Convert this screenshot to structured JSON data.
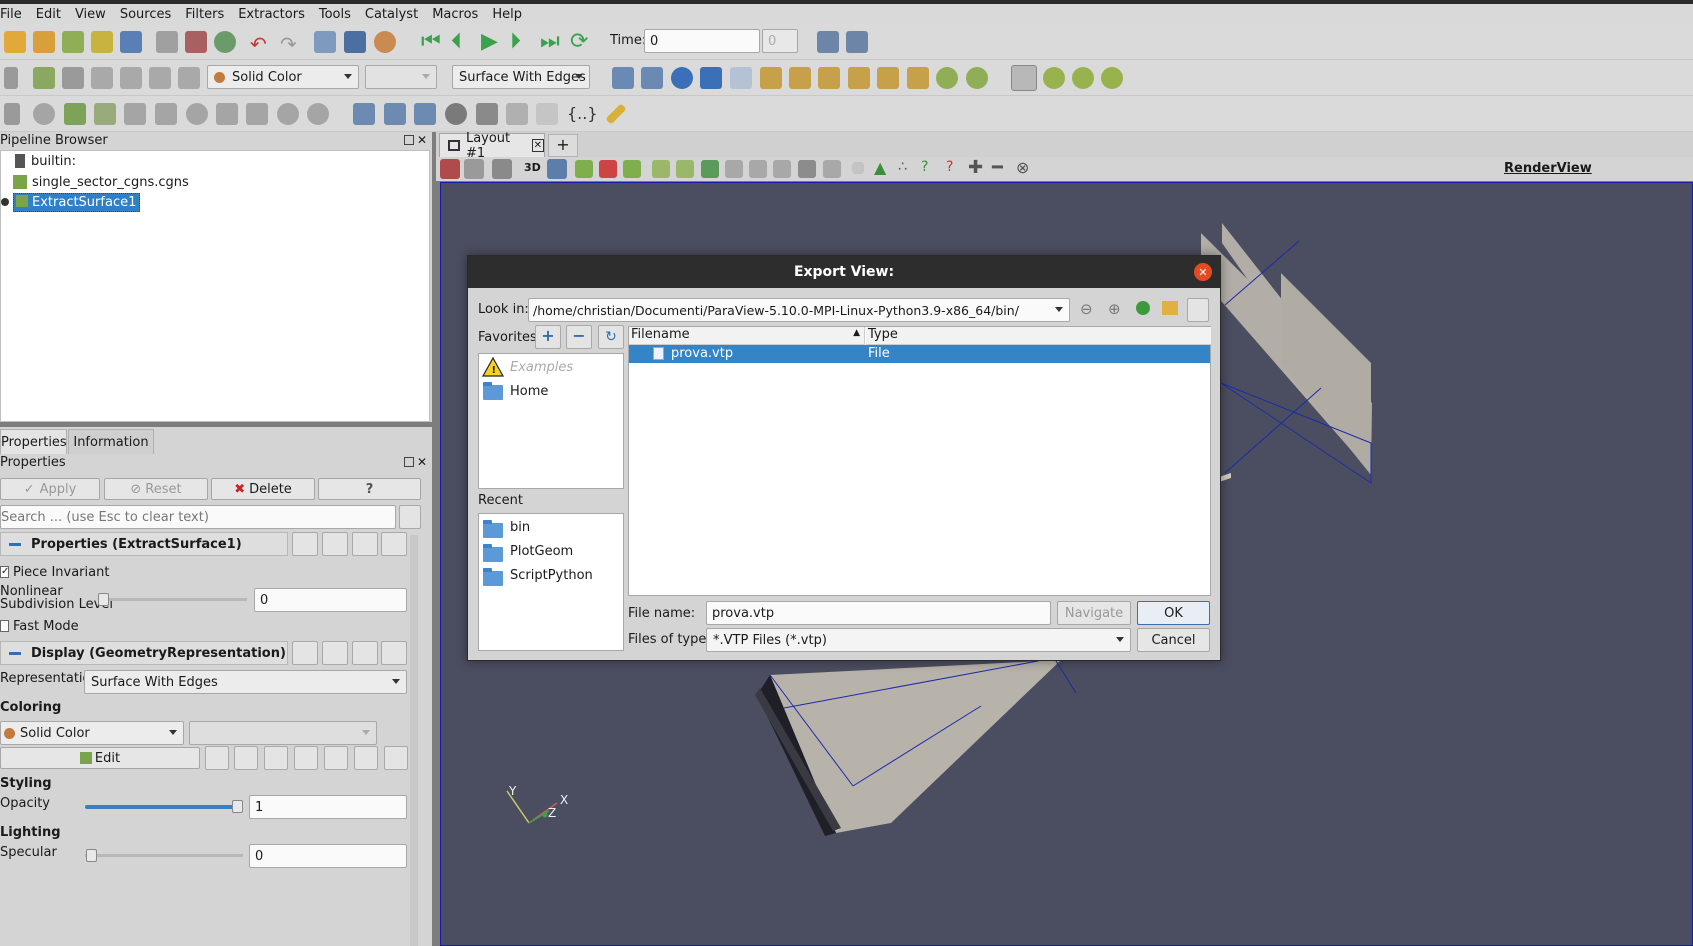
{
  "menu": [
    "File",
    "Edit",
    "View",
    "Sources",
    "Filters",
    "Extractors",
    "Tools",
    "Catalyst",
    "Macros",
    "Help"
  ],
  "toolbar": {
    "time_label": "Time:",
    "time_value": "0",
    "time_index": "0",
    "coloring_value": "Solid Color",
    "representation_value": "Surface With Edges",
    "view3d_label": "3D"
  },
  "pipeline": {
    "title": "Pipeline Browser",
    "items": [
      "builtin:",
      "single_sector_cgns.cgns",
      "ExtractSurface1"
    ]
  },
  "tabs": {
    "layout": "Layout #1",
    "add": "+",
    "properties_tab": "Properties",
    "information_tab": "Information"
  },
  "render_view_label": "RenderView",
  "properties": {
    "title": "Properties",
    "apply": "Apply",
    "reset": "Reset",
    "delete": "Delete",
    "help": "?",
    "search_placeholder": "Search ... (use Esc to clear text)",
    "section_props": "Properties (ExtractSurface1)",
    "piece_invariant": "Piece Invariant",
    "nonlinear_label_1": "Nonlinear",
    "nonlinear_label_2": "Subdivision Level",
    "nonlinear_value": "0",
    "fast_mode": "Fast Mode",
    "section_display": "Display (GeometryRepresentation)",
    "representation_label": "Representation",
    "representation_value": "Surface With Edges",
    "coloring_label": "Coloring",
    "coloring_value": "Solid Color",
    "edit": "Edit",
    "styling_label": "Styling",
    "opacity_label": "Opacity",
    "opacity_value": "1",
    "lighting_label": "Lighting",
    "specular_label": "Specular",
    "specular_value": "0"
  },
  "dialog": {
    "title": "Export View:",
    "look_in_label": "Look in:",
    "look_in_path": "/home/christian/Documenti/ParaView-5.10.0-MPI-Linux-Python3.9-x86_64/bin/",
    "favorites_label": "Favorites",
    "favorites": [
      "Examples",
      "Home"
    ],
    "recent_label": "Recent",
    "recent": [
      "bin",
      "PlotGeom",
      "ScriptPython"
    ],
    "columns": [
      "Filename",
      "Type"
    ],
    "files": [
      {
        "name": "prova.vtp",
        "type": "File"
      }
    ],
    "file_name_label": "File name:",
    "file_name_value": "prova.vtp",
    "navigate": "Navigate",
    "ok": "OK",
    "files_of_type_label": "Files of type:",
    "files_of_type_value": "*.VTP Files (*.vtp)",
    "cancel": "Cancel"
  },
  "axes": {
    "y": "Y",
    "x": "X",
    "z": "Z"
  }
}
